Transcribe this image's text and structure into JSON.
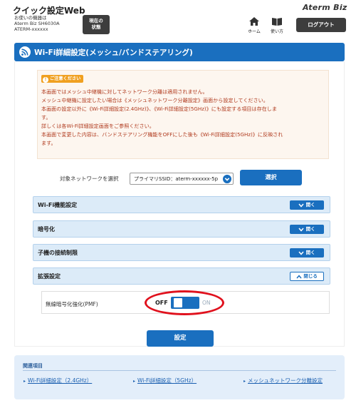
{
  "header": {
    "app_title": "クイック設定Web",
    "device_caption": "お使いの機器は",
    "device_model": "Aterm Biz SH6030A",
    "device_id": "ATERM-xxxxxx",
    "status_button": [
      "現在の",
      "状態"
    ],
    "brand": "Aterm Biz",
    "home_label": "ホーム",
    "usage_label": "使い方",
    "logout_label": "ログアウト"
  },
  "page": {
    "title": "Wi-Fi詳細設定(メッシュ/バンドステアリング)"
  },
  "caution": {
    "badge": "ご注意ください",
    "lines": [
      "本画面ではメッシュ中継機に対してネットワーク分離は適用されません。",
      "メッシュ中継機に設定したい場合は《メッシュネットワーク分離設定》画面から設定してください。",
      "本画面の設定以外に《Wi-Fi詳細設定(2.4GHz)》、《Wi-Fi詳細設定(5GHz)》にも設定する項目は存在しま",
      "す。",
      "詳しくは各Wi-Fi詳細設定画面をご参照ください。",
      "本画面で変更した内容は、バンドステアリング機能をOFFにした後も《Wi-Fi詳細設定(5GHz)》に反映され",
      "ます。"
    ]
  },
  "network_select": {
    "label": "対象ネットワークを選択",
    "value": "プライマリSSID：aterm-xxxxxx-5p",
    "button": "選択"
  },
  "sections": [
    {
      "label": "Wi-Fi機能設定",
      "button": "開く",
      "state": "collapsed"
    },
    {
      "label": "暗号化",
      "button": "開く",
      "state": "collapsed"
    },
    {
      "label": "子機の接続制限",
      "button": "開く",
      "state": "collapsed"
    },
    {
      "label": "拡張設定",
      "button": "閉じる",
      "state": "expanded"
    }
  ],
  "pmf": {
    "label": "無線暗号化強化(PMF)",
    "off_label": "OFF",
    "on_label": "ON",
    "value": "OFF"
  },
  "submit_label": "設定",
  "related": {
    "title": "関連項目",
    "links": [
      "Wi-Fi詳細設定（2.4GHz）",
      "Wi-Fi詳細設定（5GHz）",
      "メッシュネットワーク分離設定"
    ]
  },
  "colors": {
    "primary": "#1a6fbf",
    "caution_text": "#b03a1e",
    "highlight": "#e0111d",
    "dark_button": "#3d3d3d"
  },
  "icons": [
    "wifi-icon",
    "home-icon",
    "book-icon",
    "chevron-down-icon",
    "chevron-up-icon",
    "info-icon",
    "arrow-right-icon"
  ]
}
